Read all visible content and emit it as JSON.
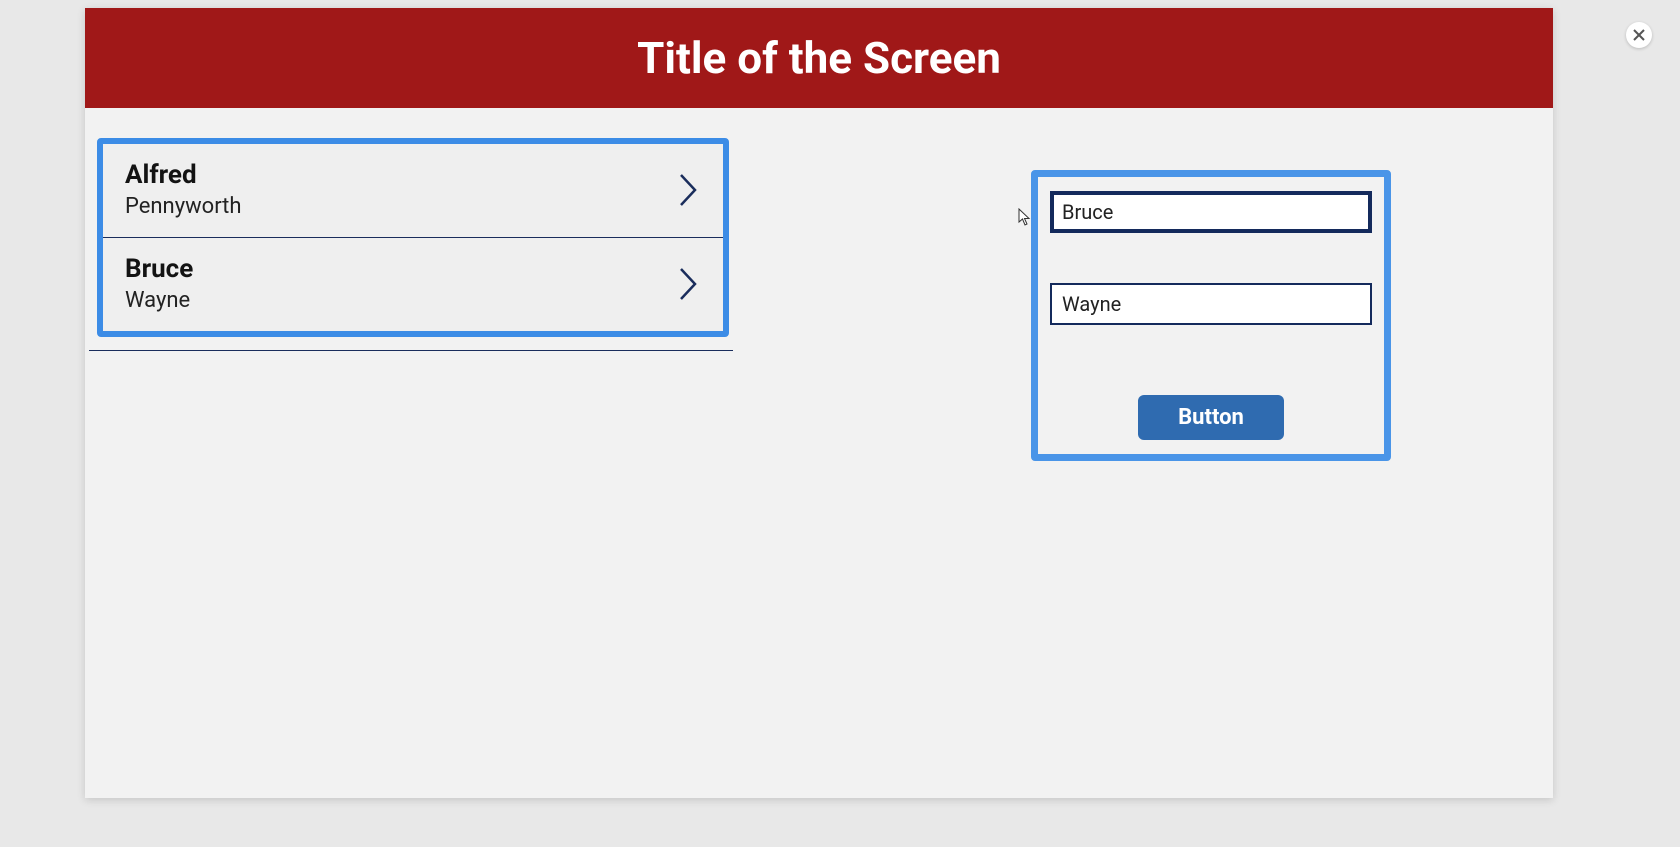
{
  "header": {
    "title": "Title of the Screen"
  },
  "list": {
    "items": [
      {
        "primary": "Alfred",
        "secondary": "Pennyworth"
      },
      {
        "primary": "Bruce",
        "secondary": "Wayne"
      }
    ]
  },
  "form": {
    "first_name_value": "Bruce",
    "last_name_value": "Wayne",
    "button_label": "Button"
  },
  "close_label": "Close"
}
